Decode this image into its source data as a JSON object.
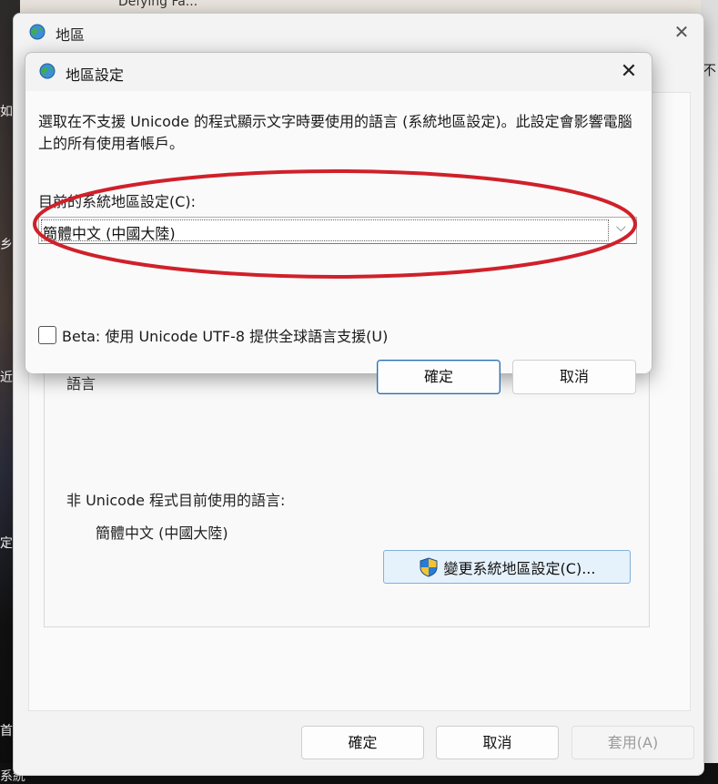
{
  "background": {
    "top_title_fragment": "Defying Fa...",
    "left_fragments": [
      "如何",
      "乡",
      "近傳的",
      "定",
      "首",
      "系統"
    ],
    "right_fragments": [
      "不"
    ]
  },
  "outer_dialog": {
    "title": "地區",
    "language_heading": "語言",
    "non_unicode_label": "非 Unicode 程式目前使用的語言:",
    "non_unicode_value": "簡體中文 (中國大陸)",
    "change_locale_button": "變更系統地區設定(C)...",
    "ok_button": "確定",
    "cancel_button": "取消",
    "apply_button": "套用(A)"
  },
  "inner_dialog": {
    "title": "地區設定",
    "description": "選取在不支援 Unicode 的程式顯示文字時要使用的語言 (系統地區設定)。此設定會影響電腦上的所有使用者帳戶。",
    "current_locale_label": "目前的系統地區設定(C):",
    "current_locale_value": "簡體中文 (中國大陸)",
    "beta_checkbox_label": "Beta: 使用 Unicode UTF-8 提供全球語言支援(U)",
    "beta_checked": false,
    "ok_button": "確定",
    "cancel_button": "取消"
  },
  "colors": {
    "annotation": "#d0202a",
    "accent_button": "#e5f1fb",
    "primary_border": "#2c6cb0"
  },
  "icons": {
    "app": "globe-icon",
    "close": "close-icon",
    "uac": "shield-icon",
    "dropdown": "chevron-down-icon"
  }
}
